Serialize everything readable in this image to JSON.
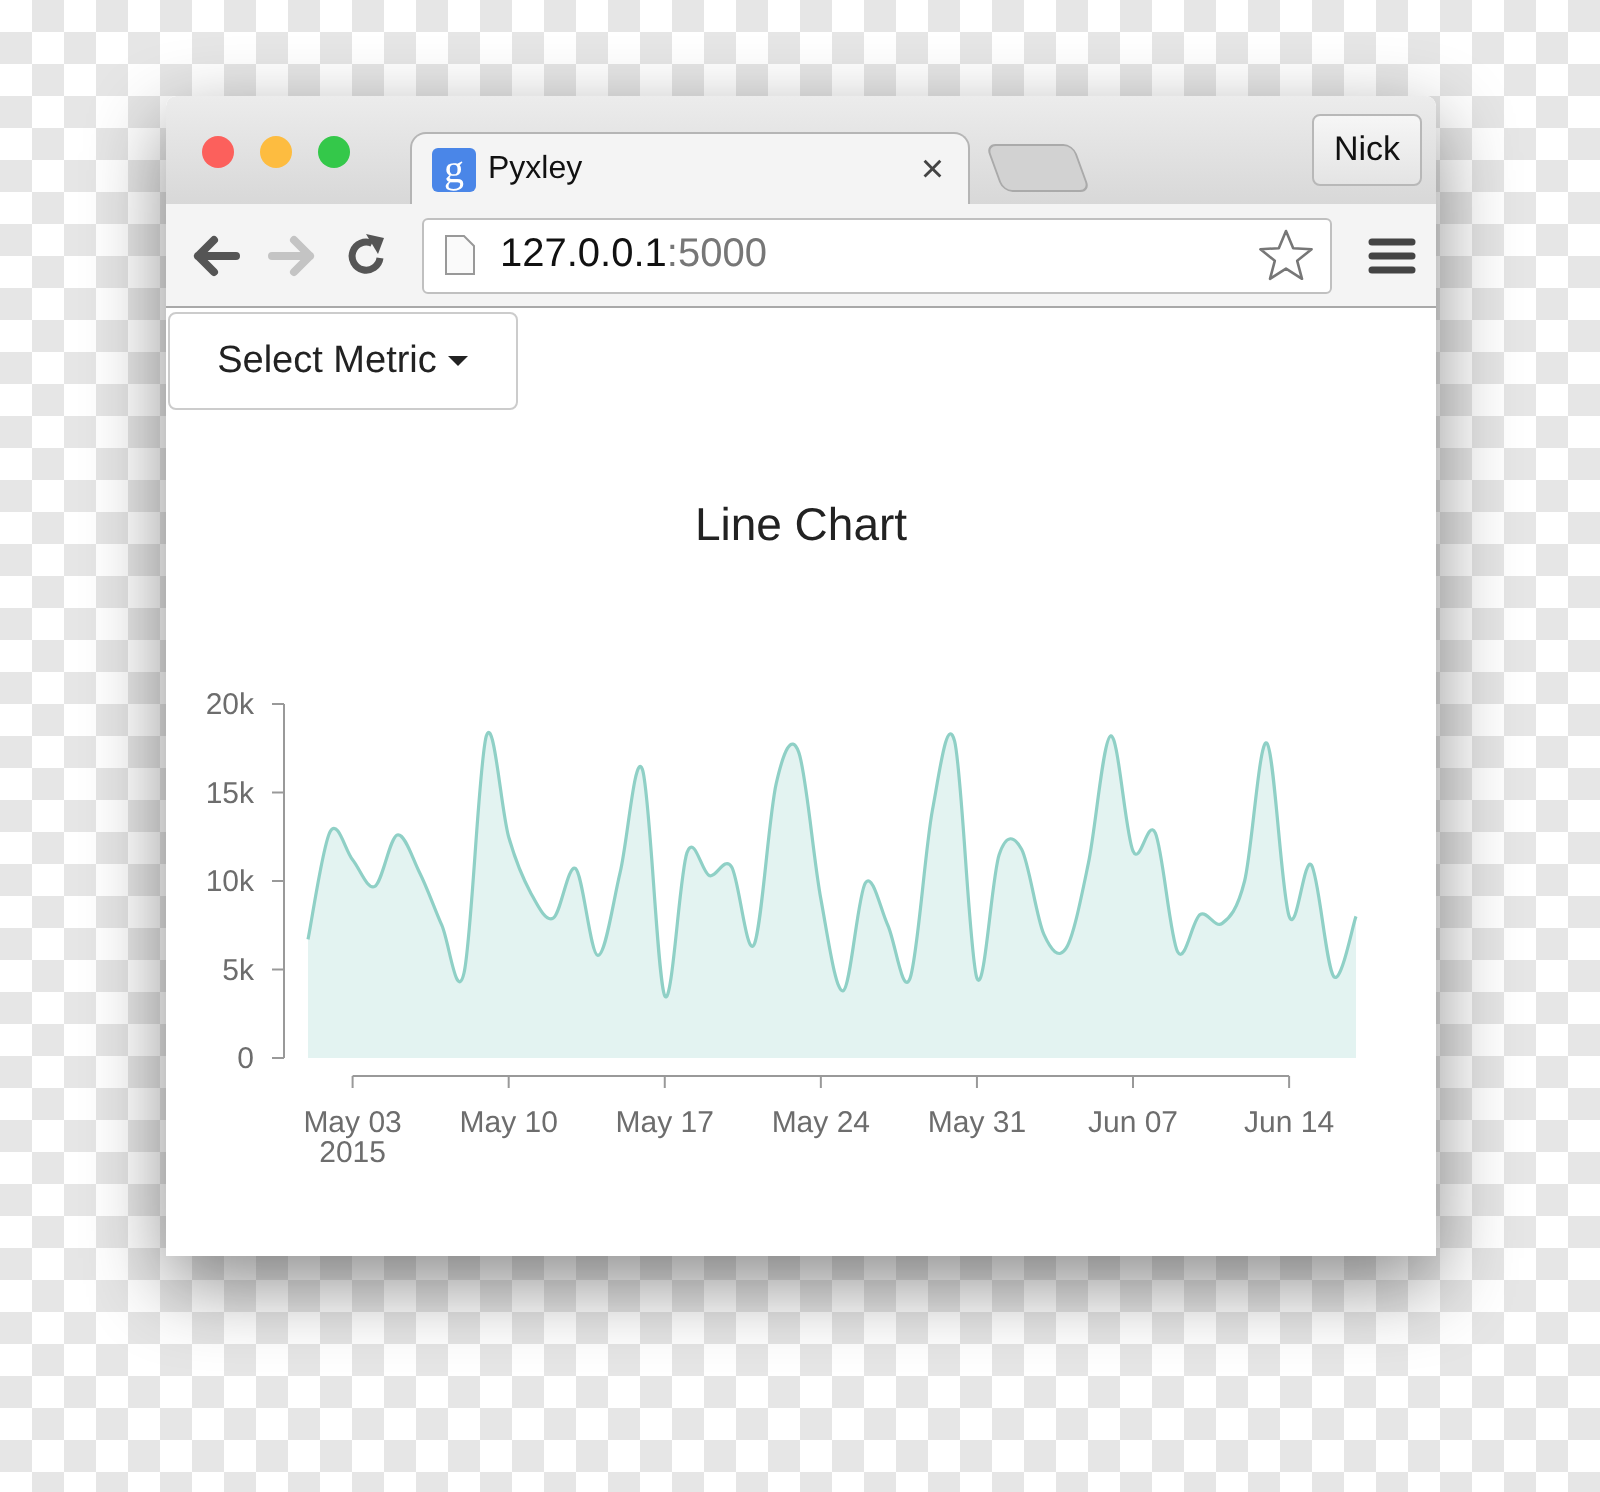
{
  "window": {
    "traffic_lights": [
      {
        "color": "#fc605c"
      },
      {
        "color": "#fdbc40"
      },
      {
        "color": "#34c84a"
      }
    ],
    "tabs": [
      {
        "label": "Pyxley",
        "icon_text": "g",
        "selected": true,
        "close": "×"
      }
    ],
    "profile_button": "Nick",
    "toolbar": {
      "back_disabled": false,
      "forward_disabled": true,
      "url_host": "127.0.0.1",
      "url_port": ":5000"
    }
  },
  "page": {
    "dropdown": {
      "label": "Select Metric",
      "expanded": false
    },
    "chart": {
      "title": "Line Chart",
      "chart_data": {
        "type": "area",
        "color": "#8fd0c6",
        "categories": [
          null,
          null,
          "May 03",
          null,
          null,
          null,
          null,
          null,
          null,
          "May 10",
          null,
          null,
          null,
          null,
          null,
          null,
          "May 17",
          null,
          null,
          null,
          null,
          null,
          null,
          "May 24",
          null,
          null,
          null,
          null,
          null,
          null,
          "May 31",
          null,
          null,
          null,
          null,
          null,
          null,
          "Jun 07",
          null,
          null,
          null,
          null,
          null,
          null,
          "Jun 14",
          null,
          null,
          null
        ],
        "values": [
          6700,
          12800,
          11200,
          9700,
          12600,
          10500,
          7500,
          4800,
          18200,
          12500,
          9300,
          7900,
          10700,
          5800,
          10500,
          16300,
          3500,
          11600,
          10300,
          10800,
          6400,
          15500,
          17300,
          9000,
          3800,
          9900,
          7500,
          4500,
          14000,
          17900,
          4500,
          11500,
          11800,
          7000,
          6200,
          11000,
          18200,
          11700,
          12700,
          6000,
          8100,
          7600,
          10000,
          17800,
          8000,
          10900,
          4600,
          8000
        ],
        "ylim": [
          0,
          20000
        ],
        "yticks": [
          {
            "value": 0,
            "label": "0"
          },
          {
            "value": 5000,
            "label": "5k"
          },
          {
            "value": 10000,
            "label": "10k"
          },
          {
            "value": 15000,
            "label": "15k"
          },
          {
            "value": 20000,
            "label": "20k"
          }
        ],
        "annotations": [
          "2015"
        ]
      }
    }
  }
}
